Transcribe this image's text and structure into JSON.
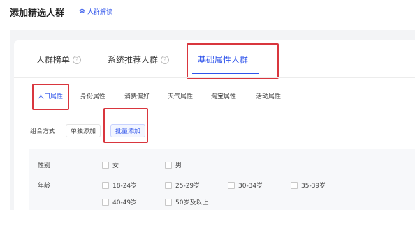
{
  "header": {
    "title": "添加精选人群",
    "explain_link": "人群解读"
  },
  "tabs": [
    {
      "label": "人群榜单",
      "has_help": true
    },
    {
      "label": "系统推荐人群",
      "has_help": true
    },
    {
      "label": "基础属性人群",
      "has_help": false,
      "active": true
    }
  ],
  "subtabs": [
    {
      "label": "人口属性",
      "active": true
    },
    {
      "label": "身份属性"
    },
    {
      "label": "消费偏好"
    },
    {
      "label": "天气属性"
    },
    {
      "label": "淘宝属性"
    },
    {
      "label": "活动属性"
    }
  ],
  "combo": {
    "label": "组合方式",
    "options": [
      "单独添加",
      "批量添加"
    ],
    "selected": "批量添加"
  },
  "filters": {
    "gender": {
      "label": "性别",
      "options": [
        "女",
        "男"
      ]
    },
    "age": {
      "label": "年龄",
      "options": [
        "18-24岁",
        "25-29岁",
        "30-34岁",
        "35-39岁",
        "40-49岁",
        "50岁及以上"
      ]
    }
  },
  "colors": {
    "accent": "#2f54eb",
    "highlight": "#d9363e"
  }
}
